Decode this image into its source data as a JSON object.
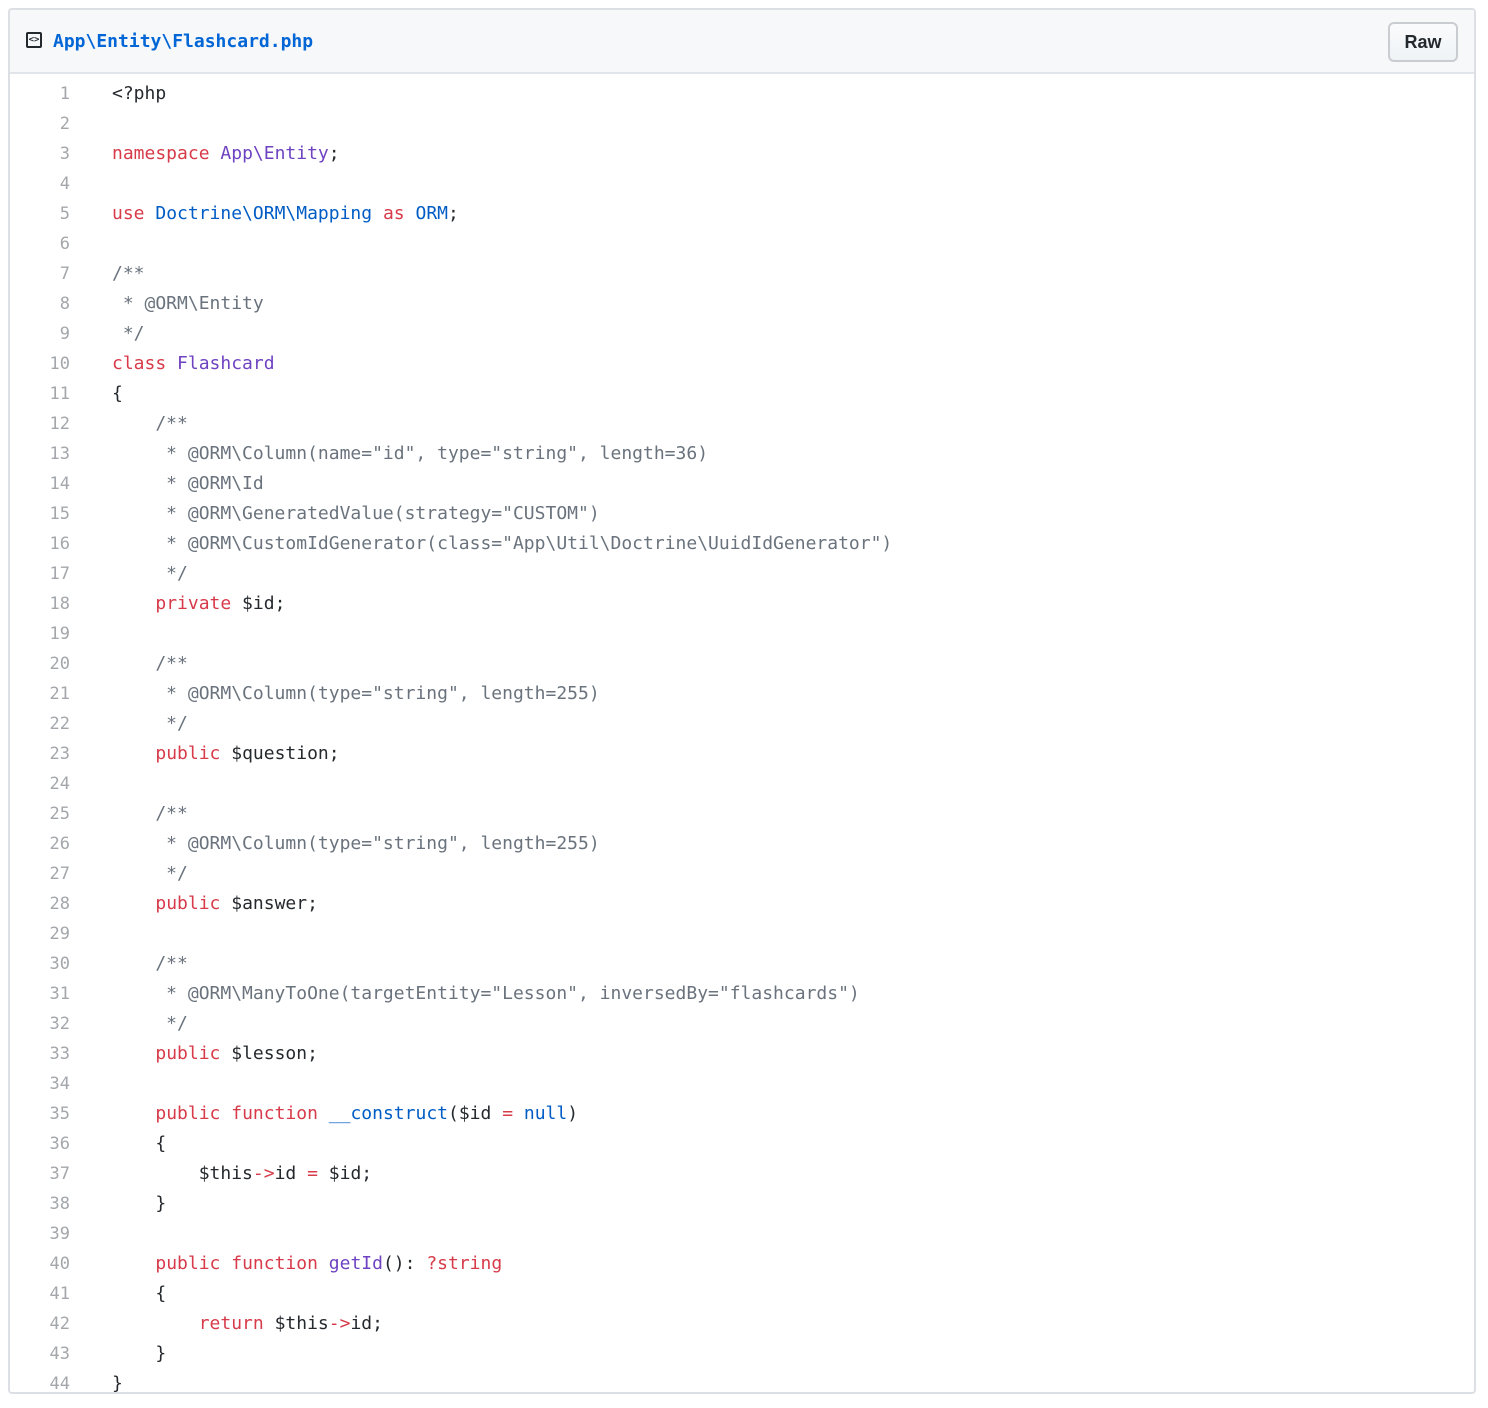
{
  "header": {
    "file_path": "App\\Entity\\Flashcard.php",
    "raw_label": "Raw",
    "icon": "file-code-icon"
  },
  "colors": {
    "keyword": "#d73a49",
    "entity": "#6f42c1",
    "comment": "#6a737d",
    "constant": "#005cc5",
    "link": "#0366d6"
  },
  "lines": [
    [
      [
        "",
        "<?php"
      ]
    ],
    [],
    [
      [
        "k",
        "namespace"
      ],
      [
        "",
        " "
      ],
      [
        "e",
        "App\\Entity"
      ],
      [
        "",
        ";"
      ]
    ],
    [],
    [
      [
        "k",
        "use"
      ],
      [
        "",
        " "
      ],
      [
        "v",
        "Doctrine\\ORM\\Mapping"
      ],
      [
        "",
        " "
      ],
      [
        "k",
        "as"
      ],
      [
        "",
        " "
      ],
      [
        "v",
        "ORM"
      ],
      [
        "",
        ";"
      ]
    ],
    [],
    [
      [
        "c",
        "/**"
      ]
    ],
    [
      [
        "c",
        " * @ORM\\Entity"
      ]
    ],
    [
      [
        "c",
        " */"
      ]
    ],
    [
      [
        "k",
        "class"
      ],
      [
        "",
        " "
      ],
      [
        "e",
        "Flashcard"
      ]
    ],
    [
      [
        "",
        "{"
      ]
    ],
    [
      [
        "c",
        "    /**"
      ]
    ],
    [
      [
        "c",
        "     * @ORM\\Column(name=\"id\", type=\"string\", length=36)"
      ]
    ],
    [
      [
        "c",
        "     * @ORM\\Id"
      ]
    ],
    [
      [
        "c",
        "     * @ORM\\GeneratedValue(strategy=\"CUSTOM\")"
      ]
    ],
    [
      [
        "c",
        "     * @ORM\\CustomIdGenerator(class=\"App\\Util\\Doctrine\\UuidIdGenerator\")"
      ]
    ],
    [
      [
        "c",
        "     */"
      ]
    ],
    [
      [
        "",
        "    "
      ],
      [
        "k",
        "private"
      ],
      [
        "",
        " $id;"
      ]
    ],
    [],
    [
      [
        "c",
        "    /**"
      ]
    ],
    [
      [
        "c",
        "     * @ORM\\Column(type=\"string\", length=255)"
      ]
    ],
    [
      [
        "c",
        "     */"
      ]
    ],
    [
      [
        "",
        "    "
      ],
      [
        "k",
        "public"
      ],
      [
        "",
        " $question;"
      ]
    ],
    [],
    [
      [
        "c",
        "    /**"
      ]
    ],
    [
      [
        "c",
        "     * @ORM\\Column(type=\"string\", length=255)"
      ]
    ],
    [
      [
        "c",
        "     */"
      ]
    ],
    [
      [
        "",
        "    "
      ],
      [
        "k",
        "public"
      ],
      [
        "",
        " $answer;"
      ]
    ],
    [],
    [
      [
        "c",
        "    /**"
      ]
    ],
    [
      [
        "c",
        "     * @ORM\\ManyToOne(targetEntity=\"Lesson\", inversedBy=\"flashcards\")"
      ]
    ],
    [
      [
        "c",
        "     */"
      ]
    ],
    [
      [
        "",
        "    "
      ],
      [
        "k",
        "public"
      ],
      [
        "",
        " $lesson;"
      ]
    ],
    [],
    [
      [
        "",
        "    "
      ],
      [
        "k",
        "public"
      ],
      [
        "",
        " "
      ],
      [
        "k",
        "function"
      ],
      [
        "",
        " "
      ],
      [
        "v",
        "__construct"
      ],
      [
        "",
        "($id "
      ],
      [
        "k",
        "="
      ],
      [
        "",
        " "
      ],
      [
        "v",
        "null"
      ],
      [
        "",
        ")"
      ]
    ],
    [
      [
        "",
        "    {"
      ]
    ],
    [
      [
        "",
        "        $this"
      ],
      [
        "k",
        "->"
      ],
      [
        "",
        "id "
      ],
      [
        "k",
        "="
      ],
      [
        "",
        " $id;"
      ]
    ],
    [
      [
        "",
        "    }"
      ]
    ],
    [],
    [
      [
        "",
        "    "
      ],
      [
        "k",
        "public"
      ],
      [
        "",
        " "
      ],
      [
        "k",
        "function"
      ],
      [
        "",
        " "
      ],
      [
        "e",
        "getId"
      ],
      [
        "",
        "(): "
      ],
      [
        "k",
        "?string"
      ]
    ],
    [
      [
        "",
        "    {"
      ]
    ],
    [
      [
        "",
        "        "
      ],
      [
        "k",
        "return"
      ],
      [
        "",
        " $this"
      ],
      [
        "k",
        "->"
      ],
      [
        "",
        "id;"
      ]
    ],
    [
      [
        "",
        "    }"
      ]
    ],
    [
      [
        "",
        "}"
      ]
    ]
  ]
}
